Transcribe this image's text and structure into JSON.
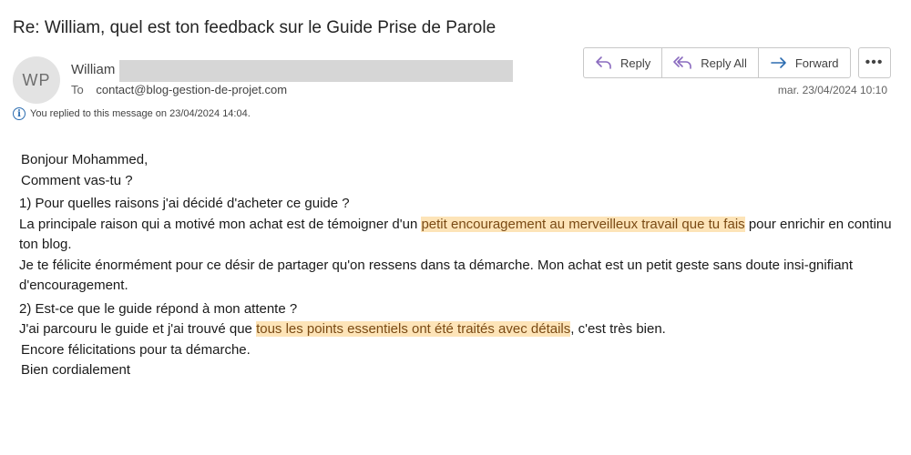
{
  "email": {
    "subject": "Re: William, quel est ton feedback sur le Guide Prise de Parole",
    "sender": {
      "initials": "WP",
      "name": "William"
    },
    "to_label": "To",
    "to_address": "contact@blog-gestion-de-projet.com",
    "date": "mar. 23/04/2024 10:10",
    "info_message": "You replied to this message on 23/04/2024 14:04."
  },
  "toolbar": {
    "reply_label": "Reply",
    "reply_all_label": "Reply All",
    "forward_label": "Forward",
    "more_label": "•••"
  },
  "body": {
    "greeting": "Bonjour Mohammed,",
    "how_are_you": "Comment vas-tu ?",
    "q1": "1) Pour quelles raisons j'ai décidé d'acheter ce guide ?",
    "p1_before": "La principale raison qui a motivé mon achat est de témoigner d'un ",
    "p1_highlight": "petit encouragement au merveilleux travail que tu fais",
    "p1_after": " pour enrichir en continu ton blog.",
    "p2": "Je te félicite énormément pour ce désir de partager qu'on ressens dans ta démarche. Mon achat est un petit geste sans doute insi-gnifiant d'encouragement.",
    "q2": "2) Est-ce que le guide répond à mon attente ?",
    "p3_before": "J'ai parcouru le guide et j'ai trouvé que ",
    "p3_highlight": "tous les points essentiels ont été traités avec détails",
    "p3_after": ", c'est très bien.",
    "congrats": "Encore félicitations pour ta démarche.",
    "closing": "Bien cordialement"
  },
  "icons": {
    "reply": "reply-arrow-icon",
    "reply_all": "reply-all-arrow-icon",
    "forward": "forward-arrow-icon",
    "info": "info-icon"
  },
  "colors": {
    "highlight_bg": "#fde4b8",
    "highlight_text": "#7a4a14",
    "icon_purple": "#8a6bbf",
    "icon_blue": "#2b6cb0"
  }
}
